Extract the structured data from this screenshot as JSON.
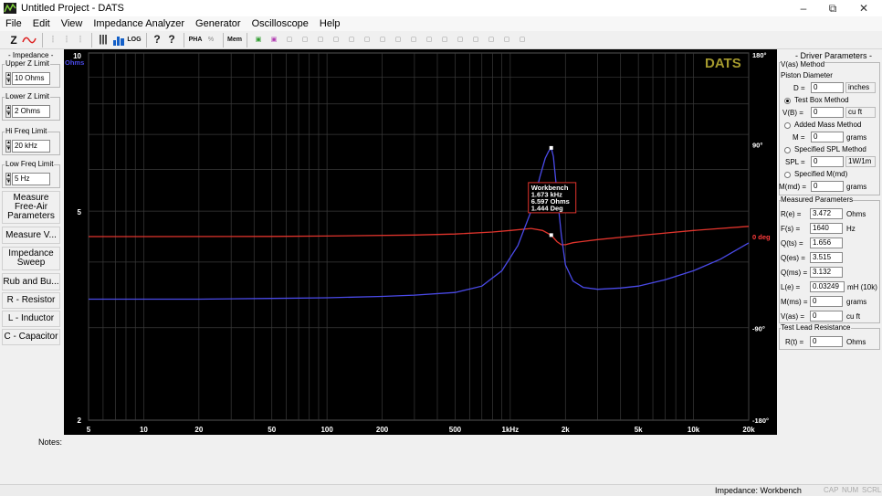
{
  "window": {
    "title": "Untitled Project - DATS"
  },
  "menu": [
    "File",
    "Edit",
    "View",
    "Impedance Analyzer",
    "Generator",
    "Oscilloscope",
    "Help"
  ],
  "toolbar": {
    "z_label": "Z",
    "mem_label": "Mem",
    "pha_label": "PHA",
    "log_label": "LOG"
  },
  "left": {
    "impedance_title": "- Impedance -",
    "upper_label": "Upper Z Limit",
    "upper_value": "10 Ohms",
    "lower_label": "Lower Z Limit",
    "lower_value": "2 Ohms",
    "hi_label": "Hi Freq Limit",
    "hi_value": "20 kHz",
    "low_label": "Low Freq Limit",
    "low_value": "5 Hz",
    "buttons": [
      "Measure Free-Air Parameters",
      "Measure V...",
      "Impedance Sweep",
      "Rub and Bu...",
      "R - Resistor",
      "L - Inductor",
      "C - Capacitor"
    ]
  },
  "plot": {
    "brand": "DATS",
    "y_unit": "Ohms",
    "y_ticks": [
      {
        "v": 10,
        "label": "10"
      },
      {
        "v": 5,
        "label": "5"
      },
      {
        "v": 2,
        "label": "2"
      }
    ],
    "x_ticks": [
      {
        "v": 5,
        "label": "5"
      },
      {
        "v": 10,
        "label": "10"
      },
      {
        "v": 20,
        "label": "20"
      },
      {
        "v": 50,
        "label": "50"
      },
      {
        "v": 100,
        "label": "100"
      },
      {
        "v": 200,
        "label": "200"
      },
      {
        "v": 500,
        "label": "500"
      },
      {
        "v": 1000,
        "label": "1kHz"
      },
      {
        "v": 2000,
        "label": "2k"
      },
      {
        "v": 5000,
        "label": "5k"
      },
      {
        "v": 10000,
        "label": "10k"
      },
      {
        "v": 20000,
        "label": "20k"
      }
    ],
    "phase_ticks": [
      {
        "v": 180,
        "label": "180°"
      },
      {
        "v": 90,
        "label": "90°"
      },
      {
        "v": 0,
        "label": "0 deg"
      },
      {
        "v": -90,
        "label": "-90°"
      },
      {
        "v": -180,
        "label": "-180°"
      }
    ],
    "colors": {
      "impedance": "#4a4ae8",
      "phase": "#e0342c",
      "grid": "#3a3a3a",
      "brand": "#a59a2e",
      "zero_label": "#ff3b3b"
    },
    "tooltip": {
      "title": "Workbench",
      "freq": "1.673 kHz",
      "ohms": "6.597 Ohms",
      "deg": "1.444 Deg"
    }
  },
  "chart_data": {
    "type": "line",
    "title": "",
    "xlabel": "",
    "ylabel": "Ohms",
    "x_scale": "log",
    "xlim": [
      5,
      20000
    ],
    "ylim": [
      2,
      10
    ],
    "y_scale": "log",
    "y2lim": [
      -180,
      180
    ],
    "grid": true,
    "series": [
      {
        "name": "",
        "axis": "impedance",
        "x": [
          5,
          10,
          20,
          50,
          100,
          200,
          300,
          500,
          700,
          900,
          1100,
          1300,
          1450,
          1550,
          1620,
          1673,
          1720,
          1800,
          1900,
          2000,
          2200,
          2500,
          3000,
          4000,
          5000,
          7000,
          10000,
          14000,
          20000
        ],
        "y": [
          3.4,
          3.4,
          3.4,
          3.41,
          3.42,
          3.44,
          3.46,
          3.5,
          3.6,
          3.85,
          4.3,
          5.0,
          5.8,
          6.3,
          6.5,
          6.597,
          6.35,
          5.4,
          4.5,
          3.95,
          3.68,
          3.58,
          3.55,
          3.57,
          3.6,
          3.7,
          3.85,
          4.05,
          4.35
        ]
      },
      {
        "name": "",
        "axis": "phase",
        "x": [
          5,
          10,
          50,
          100,
          300,
          500,
          800,
          1000,
          1300,
          1500,
          1673,
          1800,
          1900,
          2000,
          2200,
          3000,
          5000,
          10000,
          20000
        ],
        "y": [
          0,
          0,
          0.2,
          0.5,
          1.5,
          2.5,
          4.5,
          6,
          8,
          6,
          1.444,
          -5,
          -8,
          -8,
          -6,
          -3,
          1,
          6,
          10
        ]
      }
    ]
  },
  "right": {
    "title": "- Driver Parameters -",
    "vas_method": "V(as) Method",
    "piston": "Piston Diameter",
    "d_label": "D =",
    "d_value": "0",
    "d_unit": "inches",
    "test_box": "Test Box Method",
    "vb_label": "V(B) =",
    "vb_value": "0",
    "vb_unit": "cu ft",
    "added_mass": "Added Mass Method",
    "m_label": "M =",
    "m_value": "0",
    "m_unit": "grams",
    "spl_method": "Specified SPL Method",
    "spl_label": "SPL =",
    "spl_value": "0",
    "spl_unit": "1W/1m",
    "spec_mmd": "Specified M(md)",
    "mmd_label": "M(md) =",
    "mmd_value": "0",
    "mmd_unit": "grams",
    "measured_title": "Measured Parameters",
    "params": [
      {
        "label": "R(e) =",
        "value": "3.472",
        "unit": "Ohms"
      },
      {
        "label": "F(s) =",
        "value": "1640",
        "unit": "Hz"
      },
      {
        "label": "Q(ts) =",
        "value": "1.656",
        "unit": ""
      },
      {
        "label": "Q(es) =",
        "value": "3.515",
        "unit": ""
      },
      {
        "label": "Q(ms) =",
        "value": "3.132",
        "unit": ""
      },
      {
        "label": "L(e) =",
        "value": "0.03249",
        "unit": "mH (10k)"
      },
      {
        "label": "M(ms) =",
        "value": "0",
        "unit": "grams"
      },
      {
        "label": "V(as) =",
        "value": "0",
        "unit": "cu ft"
      }
    ],
    "lead_title": "Test Lead Resistance",
    "rt_label": "R(t) =",
    "rt_value": "0",
    "rt_unit": "Ohms"
  },
  "notes_label": "Notes:",
  "status": {
    "main": "Impedance: Workbench",
    "cap": "CAP",
    "num": "NUM",
    "scrl": "SCRL"
  }
}
